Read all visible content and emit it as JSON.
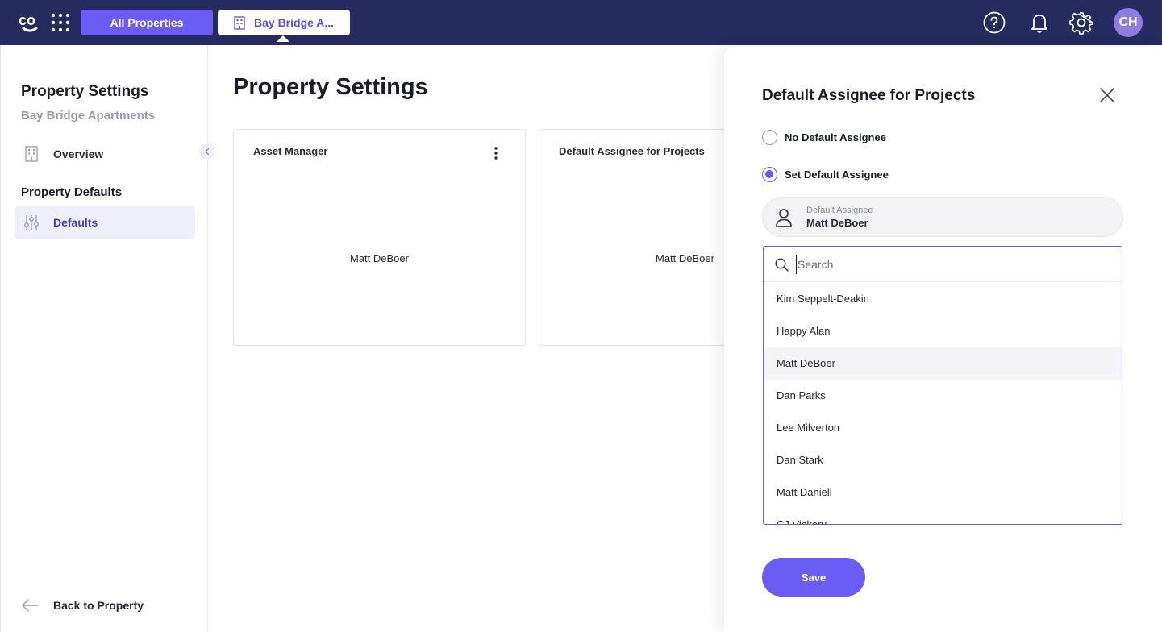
{
  "topbar": {
    "logo_text": "co",
    "all_properties_label": "All Properties",
    "property_tab_label": "Bay Bridge A...",
    "avatar_initials": "CH",
    "bg_color": "#252b5e",
    "accent_color": "#6b5cf5"
  },
  "sidebar": {
    "title": "Property Settings",
    "subtitle": "Bay Bridge Apartments",
    "overview_label": "Overview",
    "section_heading": "Property Defaults",
    "defaults_label": "Defaults",
    "back_label": "Back to Property"
  },
  "main": {
    "title": "Property Settings",
    "cards": [
      {
        "title": "Asset Manager",
        "value": "Matt DeBoer"
      },
      {
        "title": "Default Assignee for Projects",
        "value": "Matt DeBoer"
      }
    ]
  },
  "drawer": {
    "title": "Default Assignee for Projects",
    "option_none": "No Default Assignee",
    "option_set": "Set Default Assignee",
    "selected_option": "Set Default Assignee",
    "field_label": "Default Assignee",
    "field_value": "Matt DeBoer",
    "search_placeholder": "Search",
    "options": [
      "Kim Seppelt-Deakin",
      "Happy Alan",
      "Matt DeBoer",
      "Dan Parks",
      "Lee Milverton",
      "Dan Stark",
      "Matt Daniell",
      "CJ Vickery"
    ],
    "highlighted_option": "Matt DeBoer",
    "save_label": "Save"
  }
}
